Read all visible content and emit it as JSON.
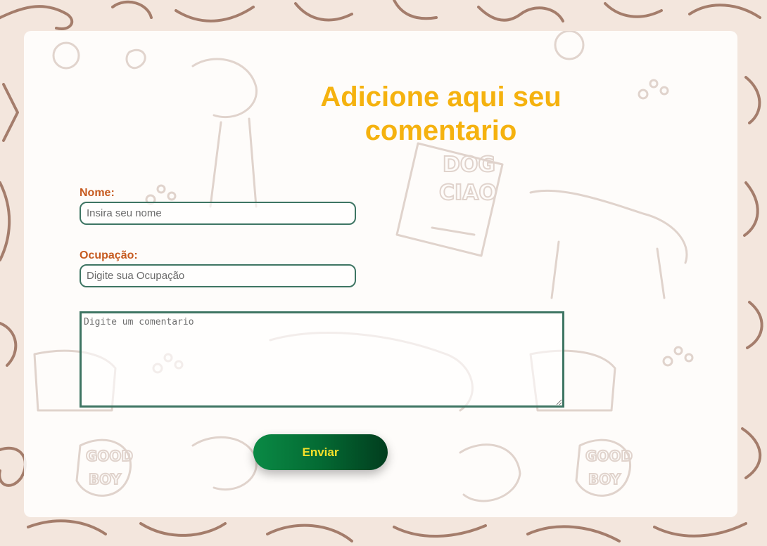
{
  "form": {
    "title": "Adicione aqui seu comentario",
    "name_label": "Nome:",
    "name_placeholder": "Insira seu nome",
    "name_value": "",
    "occupation_label": "Ocupação:",
    "occupation_placeholder": "Digite sua Ocupação",
    "occupation_value": "",
    "comment_placeholder": "Digite um comentario",
    "comment_value": "",
    "submit_label": "Enviar"
  },
  "background": {
    "doodle_texts": [
      "DOG",
      "CIAO",
      "GOOD",
      "BOY"
    ]
  },
  "colors": {
    "title": "#f5b20f",
    "label": "#c65a1f",
    "input_border": "#3e7563",
    "button_gradient_start": "#0a8a45",
    "button_gradient_end": "#013d1e",
    "button_text": "#f5e12a",
    "page_background": "#f3e6dd"
  },
  "icons": {
    "background": "dog-doodle-pattern",
    "resize_handle": "resize-grip-icon"
  }
}
